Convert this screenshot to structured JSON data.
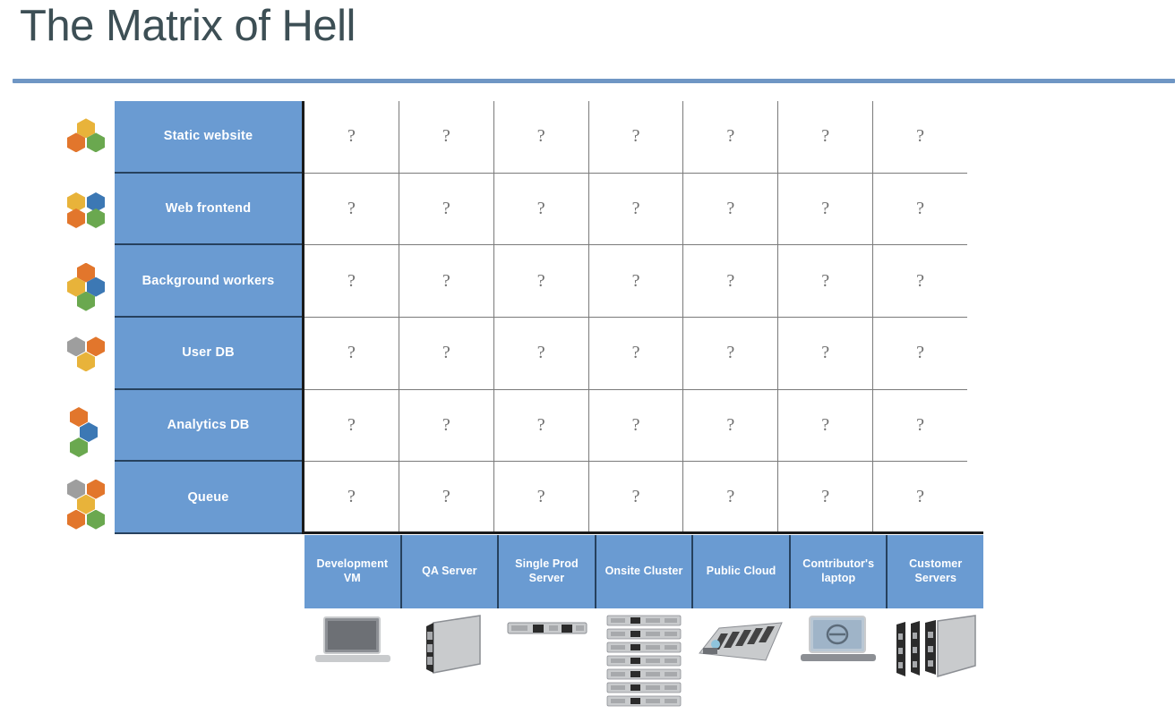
{
  "slide": {
    "title": "The Matrix of Hell",
    "accent_color": "#6f96c4",
    "header_blue": "#6a9bd2",
    "title_color": "#3d4f55",
    "cell_mark": "?",
    "cell_mark_color": "#6e6e6e"
  },
  "matrix": {
    "rows": [
      {
        "label": "Static website",
        "icon": "hexagon-cluster-3",
        "hex_colors": [
          "#e8b33a",
          "#e2762c",
          "#6aa84f"
        ]
      },
      {
        "label": "Web frontend",
        "icon": "hexagon-cluster-4",
        "hex_colors": [
          "#e8b33a",
          "#3c78b4",
          "#e2762c",
          "#6aa84f"
        ]
      },
      {
        "label": "Background workers",
        "icon": "hexagon-cluster-4-diamond",
        "hex_colors": [
          "#e2762c",
          "#e8b33a",
          "#3c78b4",
          "#6aa84f"
        ]
      },
      {
        "label": "User DB",
        "icon": "hexagon-cluster-3-gray",
        "hex_colors": [
          "#9e9e9e",
          "#e2762c",
          "#e8b33a"
        ]
      },
      {
        "label": "Analytics DB",
        "icon": "hexagon-cluster-3-vertical",
        "hex_colors": [
          "#e2762c",
          "#3c78b4",
          "#6aa84f"
        ]
      },
      {
        "label": "Queue",
        "icon": "hexagon-cluster-5",
        "hex_colors": [
          "#9e9e9e",
          "#e2762c",
          "#e8b33a",
          "#e2762c",
          "#6aa84f"
        ]
      }
    ],
    "columns": [
      {
        "label": "Development VM",
        "icon": "laptop-icon"
      },
      {
        "label": "QA Server",
        "icon": "blade-server-icon"
      },
      {
        "label": "Single Prod Server",
        "icon": "rack-unit-icon"
      },
      {
        "label": "Onsite Cluster",
        "icon": "rack-stack-icon"
      },
      {
        "label": "Public Cloud",
        "icon": "datacenter-icon"
      },
      {
        "label": "Contributor's laptop",
        "icon": "laptop-logo-icon"
      },
      {
        "label": "Customer Servers",
        "icon": "blade-servers-icon"
      }
    ],
    "cells": [
      [
        "?",
        "?",
        "?",
        "?",
        "?",
        "?",
        "?"
      ],
      [
        "?",
        "?",
        "?",
        "?",
        "?",
        "?",
        "?"
      ],
      [
        "?",
        "?",
        "?",
        "?",
        "?",
        "?",
        "?"
      ],
      [
        "?",
        "?",
        "?",
        "?",
        "?",
        "?",
        "?"
      ],
      [
        "?",
        "?",
        "?",
        "?",
        "?",
        "?",
        "?"
      ],
      [
        "?",
        "?",
        "?",
        "?",
        "?",
        "?",
        "?"
      ]
    ]
  }
}
